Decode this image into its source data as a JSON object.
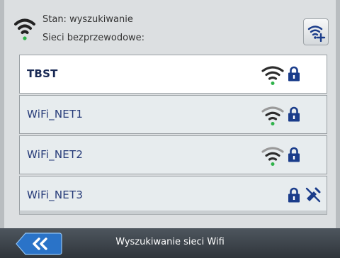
{
  "status": {
    "line1": "Stan: wyszukiwanie",
    "line2": "Sieci bezprzewodowe:"
  },
  "networks": [
    {
      "name": "TBST",
      "signal_icon": "wifi-signal-icon",
      "lock_icon": "lock-icon"
    },
    {
      "name": "WiFi_NET1",
      "signal_icon": "wifi-signal-icon",
      "lock_icon": "lock-icon"
    },
    {
      "name": "WiFi_NET2",
      "signal_icon": "wifi-signal-icon",
      "lock_icon": "lock-icon"
    },
    {
      "name": "WiFi_NET3",
      "lock_icon": "lock-icon",
      "signal_icon": "no-signal-icon"
    }
  ],
  "footer": {
    "title": "Wyszukiwanie sieci Wifi",
    "back_icon": "double-chevron-left-icon"
  },
  "colors": {
    "accent": "#1a3c8a",
    "signal_dot": "#2fb34a",
    "back_button": "#2a73c8"
  }
}
